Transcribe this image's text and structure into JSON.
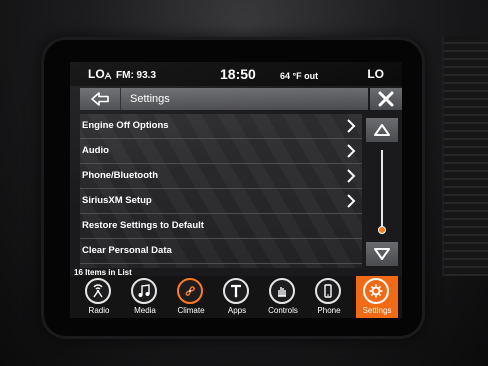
{
  "status_bar": {
    "left_zone": "LO",
    "radio": "FM: 93.3",
    "time": "18:50",
    "temperature": "64 °F out",
    "right_zone": "LO"
  },
  "header": {
    "title": "Settings"
  },
  "settings_list": {
    "items": [
      {
        "label": "Engine Off Options",
        "has_arrow": true
      },
      {
        "label": "Audio",
        "has_arrow": true
      },
      {
        "label": "Phone/Bluetooth",
        "has_arrow": true
      },
      {
        "label": "SiriusXM Setup",
        "has_arrow": true
      },
      {
        "label": "Restore Settings to Default",
        "has_arrow": false
      },
      {
        "label": "Clear Personal Data",
        "has_arrow": false
      }
    ],
    "count_text": "16 Items in List",
    "scroll_position": 0.95
  },
  "bottom_nav": {
    "items": [
      {
        "label": "Radio",
        "icon": "radio-icon"
      },
      {
        "label": "Media",
        "icon": "music-note-icon"
      },
      {
        "label": "Climate",
        "icon": "climate-fan-icon"
      },
      {
        "label": "Apps",
        "icon": "apps-icon"
      },
      {
        "label": "Controls",
        "icon": "controls-hand-icon"
      },
      {
        "label": "Phone",
        "icon": "phone-icon"
      },
      {
        "label": "Settings",
        "icon": "gear-icon"
      }
    ],
    "selected": "Settings"
  },
  "colors": {
    "accent": "#f26a14",
    "scroll_thumb": "#ff7a1a"
  }
}
